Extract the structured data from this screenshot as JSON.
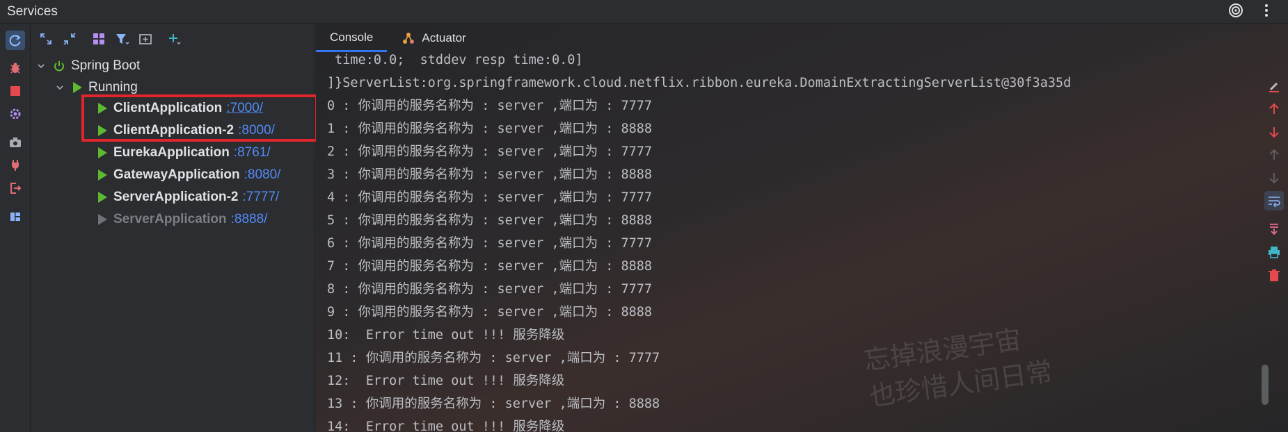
{
  "window": {
    "title": "Services"
  },
  "tree": {
    "group": "Spring Boot",
    "status_group": "Running",
    "items": [
      {
        "name": "ClientApplication",
        "port": ":7000/"
      },
      {
        "name": "ClientApplication-2",
        "port": ":8000/"
      },
      {
        "name": "EurekaApplication",
        "port": ":8761/"
      },
      {
        "name": "GatewayApplication",
        "port": ":8080/"
      },
      {
        "name": "ServerApplication-2",
        "port": ":7777/"
      },
      {
        "name": "ServerApplication",
        "port": ":8888/"
      }
    ]
  },
  "tabs": [
    {
      "label": "Console"
    },
    {
      "label": "Actuator"
    }
  ],
  "console": {
    "lines": [
      " time:0.0;  stddev resp time:0.0]",
      "]}ServerList:org.springframework.cloud.netflix.ribbon.eureka.DomainExtractingServerList@30f3a35d",
      "0 : 你调用的服务名称为 : server ,端口为 : 7777",
      "1 : 你调用的服务名称为 : server ,端口为 : 8888",
      "2 : 你调用的服务名称为 : server ,端口为 : 7777",
      "3 : 你调用的服务名称为 : server ,端口为 : 8888",
      "4 : 你调用的服务名称为 : server ,端口为 : 7777",
      "5 : 你调用的服务名称为 : server ,端口为 : 8888",
      "6 : 你调用的服务名称为 : server ,端口为 : 7777",
      "7 : 你调用的服务名称为 : server ,端口为 : 8888",
      "8 : 你调用的服务名称为 : server ,端口为 : 7777",
      "9 : 你调用的服务名称为 : server ,端口为 : 8888",
      "10:  Error time out !!! 服务降级",
      "11 : 你调用的服务名称为 : server ,端口为 : 7777",
      "12:  Error time out !!! 服务降级",
      "13 : 你调用的服务名称为 : server ,端口为 : 8888",
      "14:  Error time out !!! 服务降级"
    ],
    "watermark": "忘掉浪漫宇宙\n也珍惜人间日常"
  },
  "colors": {
    "accent": "#3574f0",
    "run_green": "#5fb832",
    "highlight_red": "#e0262c",
    "port_blue": "#548af7"
  }
}
